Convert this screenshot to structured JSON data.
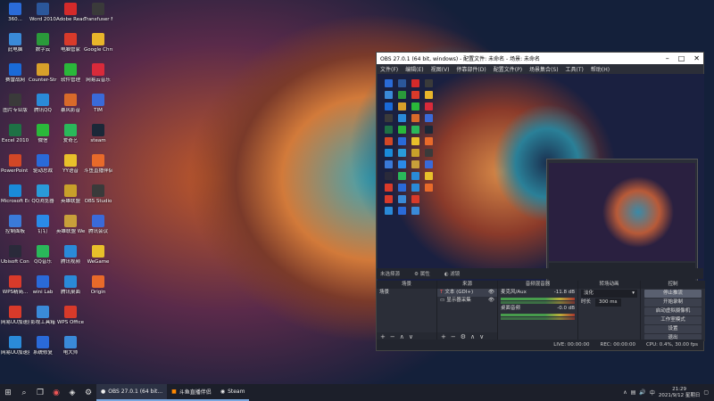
{
  "desktop_icons": [
    {
      "label": "360...",
      "color": "#2a6bd8",
      "col": 0,
      "row": 0
    },
    {
      "label": "Word 2010",
      "color": "#2b579a",
      "col": 1,
      "row": 0
    },
    {
      "label": "Adobe Reader XI",
      "color": "#d42a2a",
      "col": 2,
      "row": 0
    },
    {
      "label": "Transfuser Family",
      "color": "#3a3a3a",
      "col": 3,
      "row": 0
    },
    {
      "label": "此电脑",
      "color": "#3a8ad8",
      "col": 0,
      "row": 1
    },
    {
      "label": "数字云",
      "color": "#2a9a3a",
      "col": 1,
      "row": 1
    },
    {
      "label": "电脑管家",
      "color": "#d83a2a",
      "col": 2,
      "row": 1
    },
    {
      "label": "Google Chrome",
      "color": "#e8b52a",
      "col": 3,
      "row": 1
    },
    {
      "label": "赛雷战网",
      "color": "#1a6ad8",
      "col": 0,
      "row": 2
    },
    {
      "label": "Counter-Strike Global Off...",
      "color": "#d8a02a",
      "col": 1,
      "row": 2
    },
    {
      "label": "软件管理",
      "color": "#2ab83a",
      "col": 2,
      "row": 2
    },
    {
      "label": "网易云音乐",
      "color": "#d82a3a",
      "col": 3,
      "row": 2
    },
    {
      "label": "图片专业版",
      "color": "#3a3a3a",
      "col": 0,
      "row": 3
    },
    {
      "label": "腾讯QQ",
      "color": "#2a8ad8",
      "col": 1,
      "row": 3
    },
    {
      "label": "暴风影音",
      "color": "#d86a2a",
      "col": 2,
      "row": 3
    },
    {
      "label": "TIM",
      "color": "#3a6ad8",
      "col": 3,
      "row": 3
    },
    {
      "label": "Excel 2010",
      "color": "#1e7145",
      "col": 0,
      "row": 4
    },
    {
      "label": "微信",
      "color": "#2ab83a",
      "col": 1,
      "row": 4
    },
    {
      "label": "爱奇艺",
      "color": "#2ab85a",
      "col": 2,
      "row": 4
    },
    {
      "label": "steam",
      "color": "#1b2838",
      "col": 3,
      "row": 4
    },
    {
      "label": "PowerPoint 2010",
      "color": "#d24726",
      "col": 0,
      "row": 5
    },
    {
      "label": "驱动总裁",
      "color": "#2a6ad8",
      "col": 1,
      "row": 5
    },
    {
      "label": "YY语音",
      "color": "#e8c02a",
      "col": 2,
      "row": 5
    },
    {
      "label": "斗鱼直播伴侣",
      "color": "#e86a2a",
      "col": 3,
      "row": 5
    },
    {
      "label": "Microsoft Edge",
      "color": "#1a8ad8",
      "col": 0,
      "row": 6
    },
    {
      "label": "QQ浏览器",
      "color": "#2a9ad8",
      "col": 1,
      "row": 6
    },
    {
      "label": "英雄联盟",
      "color": "#c8a02a",
      "col": 2,
      "row": 6
    },
    {
      "label": "OBS Studio",
      "color": "#3a3a3a",
      "col": 3,
      "row": 6
    },
    {
      "label": "控制面板",
      "color": "#3a7ad8",
      "col": 0,
      "row": 7
    },
    {
      "label": "钉钉",
      "color": "#2a8ae8",
      "col": 1,
      "row": 7
    },
    {
      "label": "英雄联盟 WeGame版",
      "color": "#c8a03a",
      "col": 2,
      "row": 7
    },
    {
      "label": "腾讯会议",
      "color": "#3a6ad8",
      "col": 3,
      "row": 7
    },
    {
      "label": "Ubisoft Connect",
      "color": "#2a2a3a",
      "col": 0,
      "row": 8
    },
    {
      "label": "QQ音乐",
      "color": "#2ab85a",
      "col": 1,
      "row": 8
    },
    {
      "label": "腾讯视频",
      "color": "#2a8ad8",
      "col": 2,
      "row": 8
    },
    {
      "label": "WeGame",
      "color": "#e8c02a",
      "col": 3,
      "row": 8
    },
    {
      "label": "WPS精简...",
      "color": "#d83a2a",
      "col": 0,
      "row": 9
    },
    {
      "label": "wini Lab",
      "color": "#2a6ad8",
      "col": 1,
      "row": 9
    },
    {
      "label": "腾讯桌面",
      "color": "#2a8ad8",
      "col": 2,
      "row": 9
    },
    {
      "label": "Origin",
      "color": "#e86a2a",
      "col": 3,
      "row": 9
    },
    {
      "label": "网易UU加速器工具",
      "color": "#d83a2a",
      "col": 0,
      "row": 10
    },
    {
      "label": "影视工具箱",
      "color": "#3a8ad8",
      "col": 1,
      "row": 10
    },
    {
      "label": "WPS Office",
      "color": "#d83a2a",
      "col": 2,
      "row": 10
    },
    {
      "label": "网易UU加速器",
      "color": "#2a8ad8",
      "col": 0,
      "row": 11
    },
    {
      "label": "系统修复",
      "color": "#2a6ad8",
      "col": 1,
      "row": 11
    },
    {
      "label": "电大师",
      "color": "#3a8ad8",
      "col": 2,
      "row": 11
    }
  ],
  "obs": {
    "title": "OBS 27.0.1 (64 bit, windows) - 配置文件: 未命名 - 场景: 未命名",
    "menu": [
      "文件(F)",
      "编辑(E)",
      "视图(V)",
      "停靠部件(D)",
      "配置文件(P)",
      "场景集合(S)",
      "工具(T)",
      "帮助(H)"
    ],
    "status_left": "未选择源",
    "status_props": "属性",
    "status_filters": "滤镜",
    "docks": {
      "scenes": {
        "title": "场景",
        "items": [
          "场景"
        ]
      },
      "sources": {
        "title": "来源",
        "items": [
          {
            "label": "文本 (GDI+)",
            "icon": "text-icon"
          },
          {
            "label": "显示器采集",
            "icon": "monitor-icon"
          }
        ]
      },
      "mixer": {
        "title": "音频混音器",
        "tracks": [
          {
            "name": "麦克风/Aux",
            "db": "-11.8 dB"
          },
          {
            "name": "桌面音频",
            "db": "-0.0 dB"
          }
        ]
      },
      "transitions": {
        "title": "转场动画",
        "type": "淡化",
        "duration_label": "时长",
        "duration": "300 ms"
      },
      "controls": {
        "title": "控制",
        "buttons": [
          "停止推流",
          "开始录制",
          "启动虚拟摄像机",
          "工作室模式",
          "设置",
          "退出"
        ]
      }
    },
    "bottom": {
      "live": "LIVE: 00:00:00",
      "rec": "REC: 00:00:00",
      "cpu": "CPU: 0.4%, 30.00 fps"
    }
  },
  "taskbar": {
    "apps": [
      {
        "label": "OBS 27.0.1 (64 bit...",
        "active": true
      },
      {
        "label": "斗鱼直播伴侣",
        "active": false
      },
      {
        "label": "Steam",
        "active": false
      }
    ],
    "time": "21:29",
    "date": "2021/9/12 星期日"
  }
}
